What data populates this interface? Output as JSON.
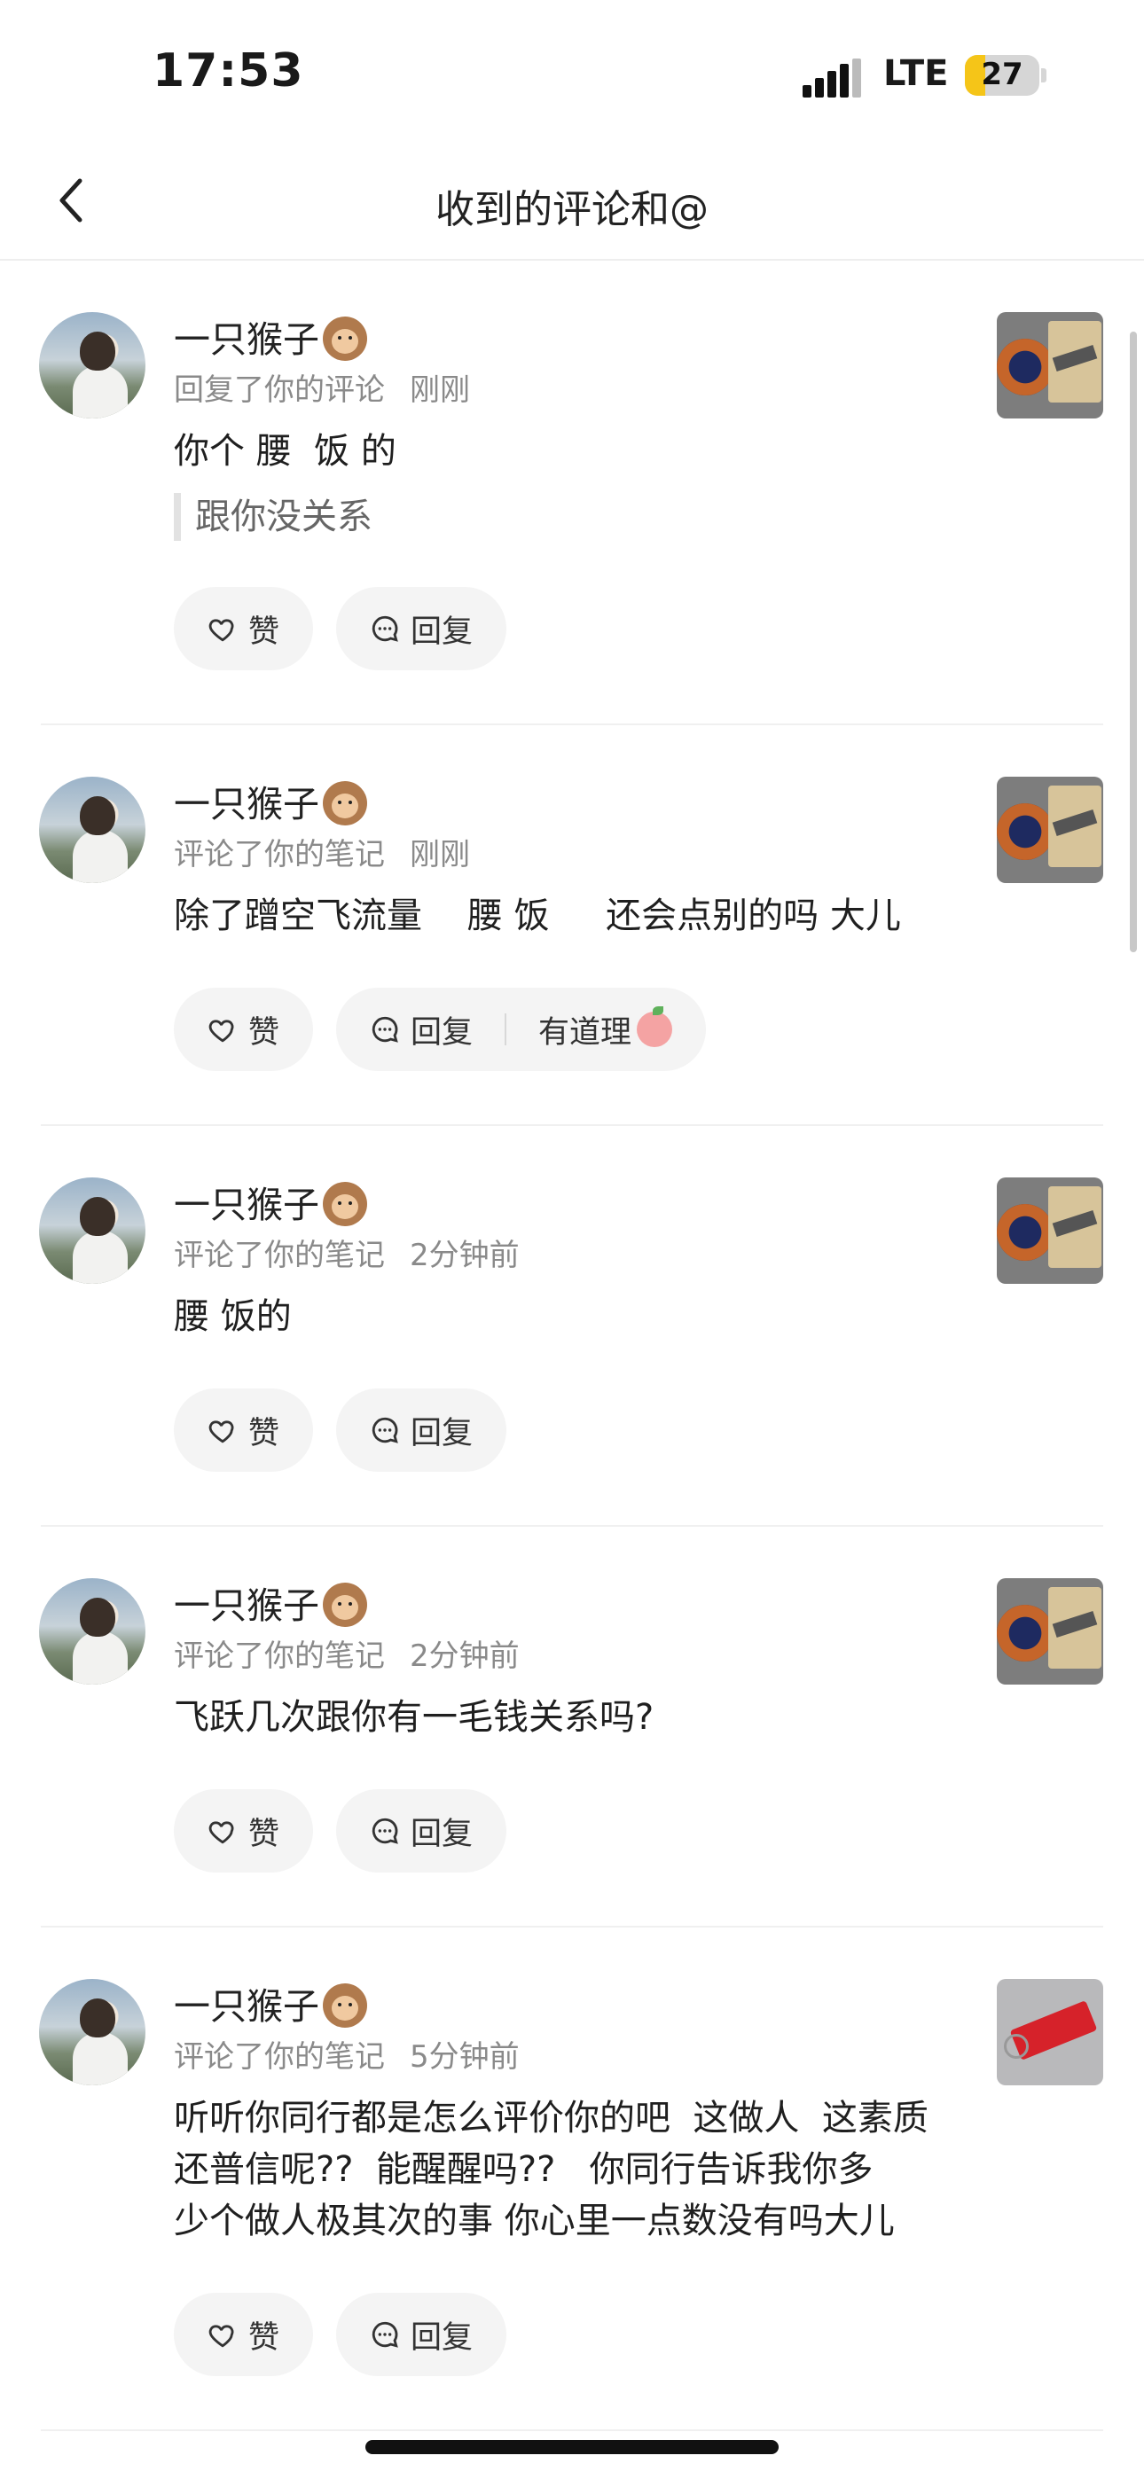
{
  "status": {
    "time": "17:53",
    "network": "LTE",
    "battery": "27",
    "battery_level": 0.27
  },
  "header": {
    "title": "收到的评论和@"
  },
  "actions": {
    "like": "赞",
    "reply": "回复"
  },
  "items": [
    {
      "name": "一只猴子",
      "action": "回复了你的评论",
      "time": "刚刚",
      "comment": "你个 腰  饭 的",
      "quote": "跟你没关系",
      "thumb": "patch"
    },
    {
      "name": "一只猴子",
      "action": "评论了你的笔记",
      "time": "刚刚",
      "comment": "除了蹭空飞流量    腰 饭     还会点别的吗 大儿",
      "extra_reaction": "有道理",
      "thumb": "patch"
    },
    {
      "name": "一只猴子",
      "action": "评论了你的笔记",
      "time": "2分钟前",
      "comment": "腰 饭的",
      "thumb": "patch"
    },
    {
      "name": "一只猴子",
      "action": "评论了你的笔记",
      "time": "2分钟前",
      "comment": "飞跃几次跟你有一毛钱关系吗?",
      "thumb": "patch"
    },
    {
      "name": "一只猴子",
      "action": "评论了你的笔记",
      "time": "5分钟前",
      "comment": "听听你同行都是怎么评价你的吧  这做人  这素质\n还普信呢??  能醒醒吗??   你同行告诉我你多\n少个做人极其次的事 你心里一点数没有吗大儿",
      "thumb": "tag"
    }
  ]
}
